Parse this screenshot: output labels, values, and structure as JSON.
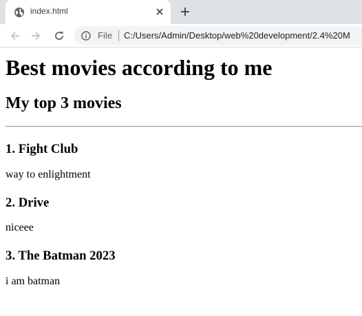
{
  "browser": {
    "tab": {
      "title": "index.html",
      "favicon": "globe-icon",
      "close_icon": "close-icon"
    },
    "new_tab_icon": "plus-icon",
    "nav": {
      "back_icon": "arrow-left-icon",
      "forward_icon": "arrow-right-icon",
      "reload_icon": "reload-icon"
    },
    "omnibox": {
      "info_icon": "info-icon",
      "scheme_label": "File",
      "url": "C:/Users/Admin/Desktop/web%20development/2.4%20M"
    }
  },
  "page": {
    "heading": "Best movies according to me",
    "subheading": "My top 3 movies",
    "movies": [
      {
        "title": "1. Fight Club",
        "description": "way to enlightment"
      },
      {
        "title": "2. Drive",
        "description": "niceee"
      },
      {
        "title": "3. The Batman 2023",
        "description": "i am batman"
      }
    ]
  },
  "colors": {
    "tabstrip_bg": "#dee1e6",
    "omnibox_bg": "#f1f3f4",
    "icon_gray": "#5f6368",
    "page_text": "#000000"
  }
}
